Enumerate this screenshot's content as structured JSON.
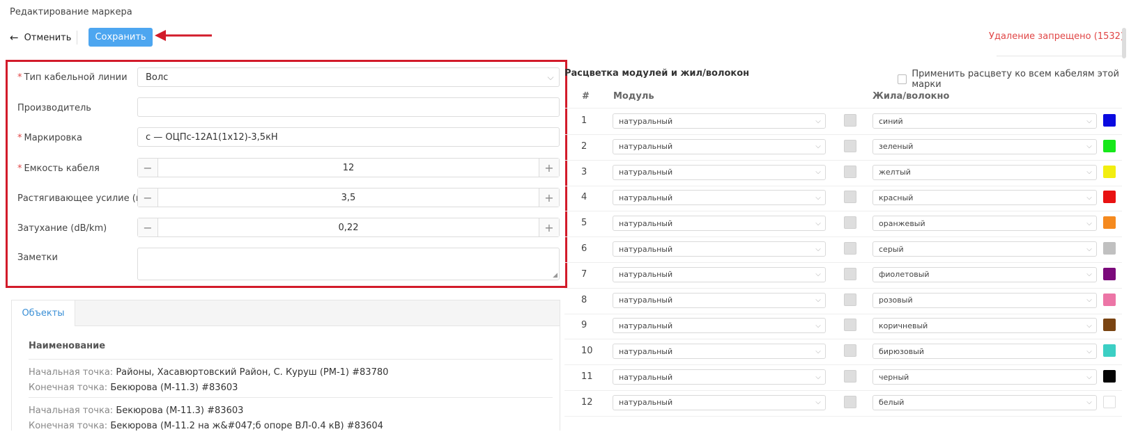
{
  "header": {
    "title": "Редактирование маркера",
    "cancel_label": "Отменить",
    "save_label": "Сохранить",
    "delete_status": "Удаление запрещено (1532)"
  },
  "form": {
    "cable_type": {
      "label": "Тип кабельной линии",
      "value": "Волс",
      "required": true
    },
    "manufacturer": {
      "label": "Производитель",
      "value": ""
    },
    "marking": {
      "label": "Маркировка",
      "value": "с — ОЦПс-12А1(1х12)-3,5кН",
      "required": true
    },
    "capacity": {
      "label": "Емкость кабеля",
      "value": "12",
      "required": true
    },
    "tension": {
      "label": "Растягивающее усилие (кН)",
      "value": "3,5"
    },
    "attenuation": {
      "label": "Затухание (dB/km)",
      "value": "0,22"
    },
    "notes": {
      "label": "Заметки",
      "value": ""
    }
  },
  "objects": {
    "tab_label": "Объекты",
    "column_header": "Наименование",
    "start_label": "Начальная точка:",
    "end_label": "Конечная точка:",
    "rows": [
      {
        "start": "Районы, Хасавюртовский Район, С. Куруш (РМ-1) #83780",
        "end": "Бекюрова (М-11.3) #83603"
      },
      {
        "start": "Бекюрова (М-11.3) #83603",
        "end": "Бекюрова (М-11.2 на ж&#047;б опоре ВЛ-0.4 кВ) #83604"
      }
    ]
  },
  "palette": {
    "title": "Расцветка модулей и жил/волокон",
    "apply_all_label": "Применить расцвету ко всем кабелям этой марки",
    "col_num": "#",
    "col_module": "Модуль",
    "col_fiber": "Жила/волокно",
    "rows": [
      {
        "num": "1",
        "module": "натуральный",
        "fiber": "синий",
        "color": "#0a0ae0"
      },
      {
        "num": "2",
        "module": "натуральный",
        "fiber": "зеленый",
        "color": "#16e81a"
      },
      {
        "num": "3",
        "module": "натуральный",
        "fiber": "желтый",
        "color": "#f2ee10"
      },
      {
        "num": "4",
        "module": "натуральный",
        "fiber": "красный",
        "color": "#e81212"
      },
      {
        "num": "5",
        "module": "натуральный",
        "fiber": "оранжевый",
        "color": "#f58a1f"
      },
      {
        "num": "6",
        "module": "натуральный",
        "fiber": "серый",
        "color": "#c0c0c0"
      },
      {
        "num": "7",
        "module": "натуральный",
        "fiber": "фиолетовый",
        "color": "#7b0a7b"
      },
      {
        "num": "8",
        "module": "натуральный",
        "fiber": "розовый",
        "color": "#ec75a6"
      },
      {
        "num": "9",
        "module": "натуральный",
        "fiber": "коричневый",
        "color": "#7a4412"
      },
      {
        "num": "10",
        "module": "натуральный",
        "fiber": "бирюзовый",
        "color": "#3ccfc4"
      },
      {
        "num": "11",
        "module": "натуральный",
        "fiber": "черный",
        "color": "#050505"
      },
      {
        "num": "12",
        "module": "натуральный",
        "fiber": "белый",
        "color": "#ffffff"
      }
    ],
    "module_swatch_color": "#dedede"
  },
  "colors": {
    "accent": "#4da6f0",
    "danger": "#e04545",
    "highlight_border": "#d21b2a",
    "link": "#3a8fd6"
  }
}
